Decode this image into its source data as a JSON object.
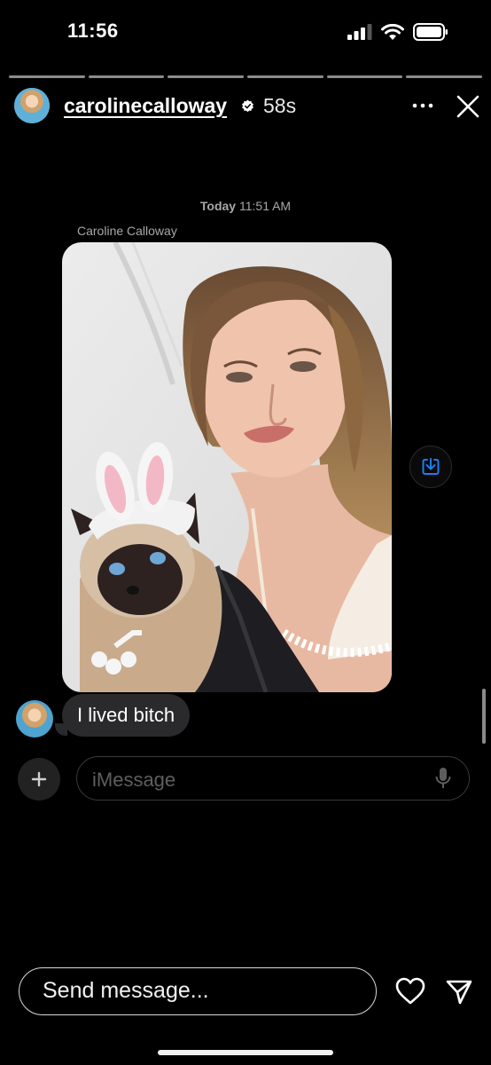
{
  "status_bar": {
    "time": "11:56"
  },
  "story": {
    "segments": 6,
    "username": "carolinecalloway",
    "elapsed": "58s"
  },
  "chat": {
    "timestamp_day": "Today",
    "timestamp_time": "11:51 AM",
    "sender_name": "Caroline Calloway",
    "message_text": "I lived bitch",
    "input_placeholder": "iMessage"
  },
  "footer": {
    "reply_placeholder": "Send message..."
  },
  "colors": {
    "accent_blue": "#1e7cf2",
    "bubble_gray": "#2a2a2c"
  }
}
